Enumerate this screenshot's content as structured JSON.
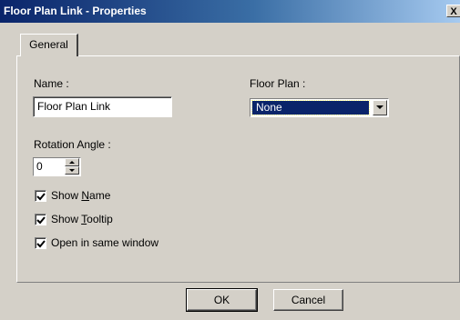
{
  "window": {
    "title": "Floor Plan Link - Properties",
    "close_glyph": "X"
  },
  "tabs": [
    {
      "label": "General",
      "selected": true
    }
  ],
  "form": {
    "name_label": "Name :",
    "name_value": "Floor Plan Link",
    "floor_plan_label": "Floor Plan :",
    "floor_plan_value": "None",
    "rotation_label": "Rotation Angle :",
    "rotation_value": "0",
    "checkboxes": [
      {
        "prefix": "Show ",
        "mnemonic": "N",
        "suffix": "ame",
        "checked": true
      },
      {
        "prefix": "Show ",
        "mnemonic": "T",
        "suffix": "ooltip",
        "checked": true
      },
      {
        "prefix": "Open in same window",
        "mnemonic": "",
        "suffix": "",
        "checked": true
      }
    ]
  },
  "buttons": {
    "ok": "OK",
    "cancel": "Cancel"
  },
  "icons": {
    "close": "close-icon",
    "dropdown": "chevron-down-icon",
    "spin_up": "arrow-up-icon",
    "spin_down": "arrow-down-icon",
    "check": "checkmark-icon"
  },
  "colors": {
    "titlebar_start": "#0a246a",
    "titlebar_end": "#a6caf0",
    "dialog_face": "#d4d0c8",
    "selection": "#0a246a"
  }
}
